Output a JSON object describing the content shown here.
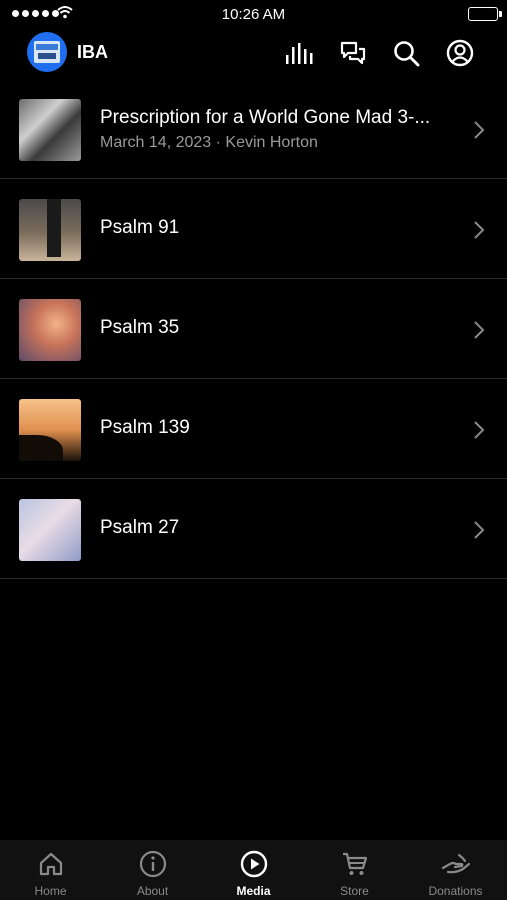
{
  "status_bar": {
    "time": "10:26 AM"
  },
  "header": {
    "app_name": "IBA",
    "icons": [
      "equalizer-icon",
      "chat-icon",
      "search-icon",
      "account-icon"
    ]
  },
  "list": {
    "items": [
      {
        "title": "Prescription for a World Gone Mad 3-...",
        "subtitle": "March 14, 2023 · Kevin Horton"
      },
      {
        "title": "Psalm 91"
      },
      {
        "title": "Psalm 35"
      },
      {
        "title": "Psalm 139"
      },
      {
        "title": "Psalm 27"
      }
    ]
  },
  "tabbar": {
    "tabs": [
      {
        "label": "Home",
        "icon": "home-icon"
      },
      {
        "label": "About",
        "icon": "info-icon"
      },
      {
        "label": "Media",
        "icon": "play-icon",
        "active": true
      },
      {
        "label": "Store",
        "icon": "cart-icon"
      },
      {
        "label": "Donations",
        "icon": "donation-hand-icon"
      }
    ]
  }
}
